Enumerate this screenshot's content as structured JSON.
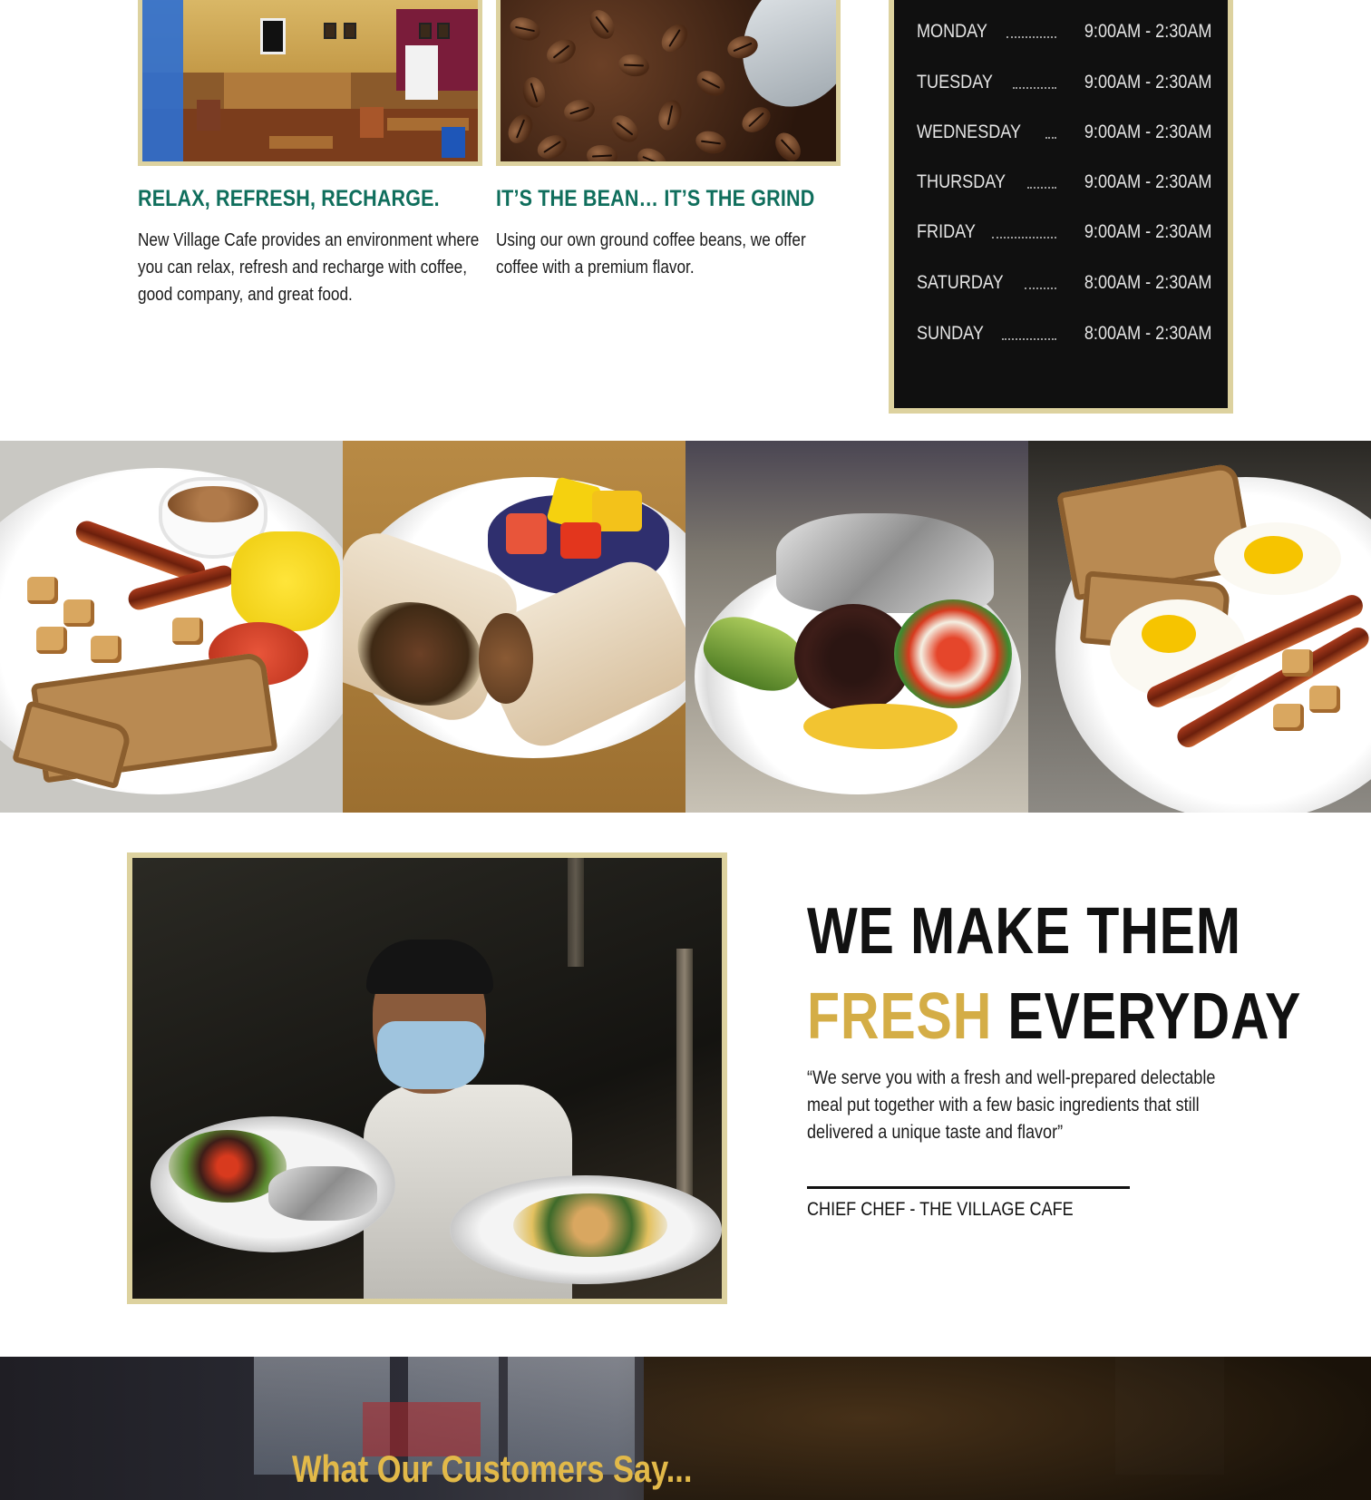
{
  "features": [
    {
      "title": "RELAX, REFRESH, RECHARGE.",
      "text": "New Village Cafe provides an environment where you can relax, refresh and recharge with coffee, good company, and great food.",
      "image": "cafe-interior-photo"
    },
    {
      "title": "IT’S THE BEAN… IT’S THE GRIND",
      "text": "Using our own ground coffee beans, we offer coffee with a premium flavor.",
      "image": "coffee-beans-photo"
    }
  ],
  "hours": [
    {
      "day": "MONDAY",
      "time": "9:00AM - 2:30AM"
    },
    {
      "day": "TUESDAY",
      "time": "9:00AM - 2:30AM"
    },
    {
      "day": "WEDNESDAY",
      "time": "9:00AM - 2:30AM"
    },
    {
      "day": "THURSDAY",
      "time": "9:00AM - 2:30AM"
    },
    {
      "day": "FRIDAY",
      "time": "9:00AM - 2:30AM"
    },
    {
      "day": "SATURDAY",
      "time": "8:00AM - 2:30AM"
    },
    {
      "day": "SUNDAY",
      "time": "8:00AM - 2:30AM"
    }
  ],
  "gallery": [
    "breakfast-plate-photo",
    "breakfast-burrito-photo",
    "huevos-bowl-photo",
    "eggs-bacon-toast-photo"
  ],
  "fresh": {
    "headline_line1": "WE MAKE THEM",
    "headline_gold": "FRESH",
    "headline_rest": " EVERYDAY",
    "quote": "“We serve you with a fresh and well-prepared delectable meal put together with a few basic ingredients that still delivered a unique taste and flavor”",
    "signature": "CHIEF CHEF -  THE VILLAGE CAFE",
    "image": "chef-holding-plates-photo"
  },
  "testimonials": {
    "heading": "What Our Customers Say..."
  },
  "colors": {
    "accent_gold": "#d4ad46",
    "frame_gold": "#ddd29f",
    "heading_green": "#0f6e5c",
    "hours_bg": "#101010"
  }
}
